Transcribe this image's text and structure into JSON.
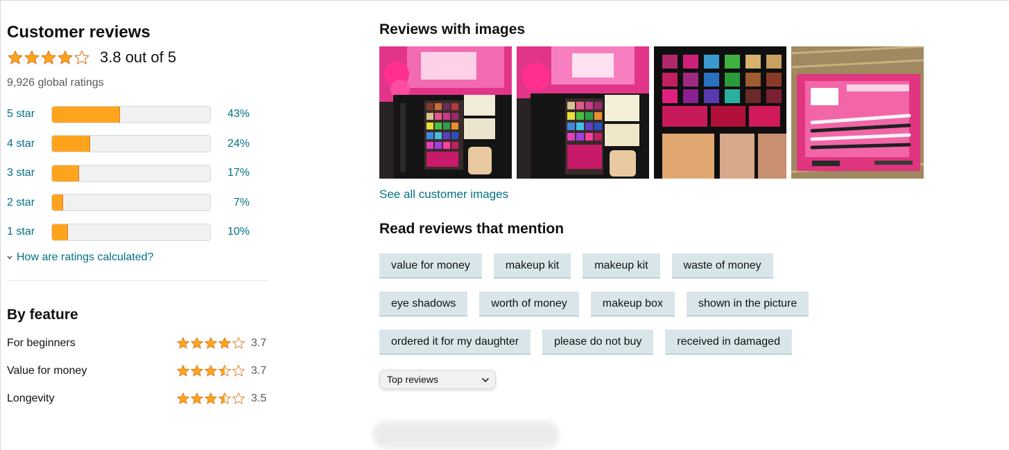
{
  "customer_reviews": {
    "title": "Customer reviews",
    "rating": 3.8,
    "rating_text": "3.8 out of 5",
    "global_ratings": "9,926 global ratings",
    "histogram": [
      {
        "label": "5 star",
        "percent_text": "43%",
        "fraction": 0.43
      },
      {
        "label": "4 star",
        "percent_text": "24%",
        "fraction": 0.24
      },
      {
        "label": "3 star",
        "percent_text": "17%",
        "fraction": 0.17
      },
      {
        "label": "2 star",
        "percent_text": "7%",
        "fraction": 0.07
      },
      {
        "label": "1 star",
        "percent_text": "10%",
        "fraction": 0.1
      }
    ],
    "how_calculated": "How are ratings calculated?"
  },
  "by_feature": {
    "title": "By feature",
    "items": [
      {
        "name": "For beginners",
        "value": "3.7",
        "stars": 4
      },
      {
        "name": "Value for money",
        "value": "3.7",
        "stars": 3.5
      },
      {
        "name": "Longevity",
        "value": "3.5",
        "stars": 3.5
      }
    ]
  },
  "reviews_with_images": {
    "title": "Reviews with images",
    "see_all": "See all customer images"
  },
  "mentions": {
    "title": "Read reviews that mention",
    "rows": [
      [
        "value for money",
        "makeup kit",
        "makeup kit",
        "waste of money"
      ],
      [
        "eye shadows",
        "worth of money",
        "makeup box",
        "shown in the picture"
      ],
      [
        "ordered it for my daughter",
        "please do not buy",
        "received in damaged"
      ]
    ]
  },
  "sort": {
    "selected": "Top reviews"
  },
  "colors": {
    "star": "#ffa41c",
    "star_stroke": "#de7921",
    "link": "#007185",
    "chip_bg": "#d9e6e9"
  }
}
